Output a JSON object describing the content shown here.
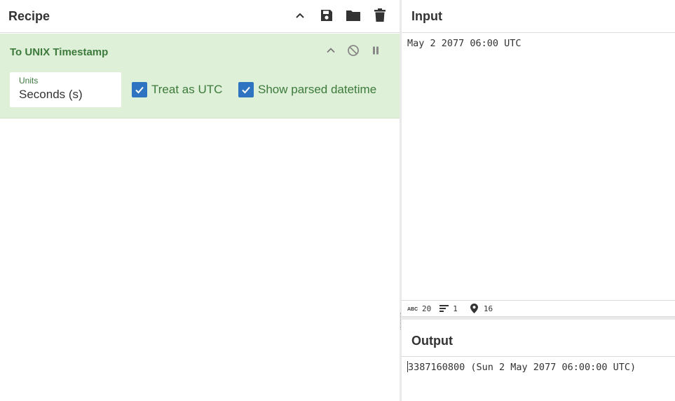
{
  "recipe": {
    "title": "Recipe",
    "icons": [
      "chevron-up-icon",
      "save-icon",
      "folder-icon",
      "trash-icon"
    ]
  },
  "operation": {
    "title": "To UNIX Timestamp",
    "units_label": "Units",
    "units_value": "Seconds (s)",
    "treat_utc_label": "Treat as UTC",
    "show_parsed_label": "Show parsed datetime",
    "treat_utc_checked": true,
    "show_parsed_checked": true
  },
  "input": {
    "title": "Input",
    "text": "May 2 2077 06:00 UTC"
  },
  "status": {
    "chars": "20",
    "lines": "1",
    "position": "16"
  },
  "output": {
    "title": "Output",
    "text": "3387160800 (Sun 2 May 2077 06:00:00 UTC)"
  },
  "colors": {
    "op_bg": "#dff0d8",
    "op_text": "#3c7a3c",
    "checkbox": "#2f74c0"
  }
}
